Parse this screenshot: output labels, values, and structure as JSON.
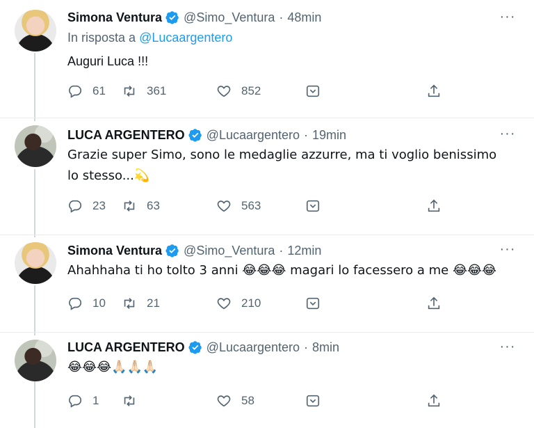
{
  "tweets": [
    {
      "name": "Simona Ventura",
      "handle": "@Simo_Ventura",
      "separator": "·",
      "time": "48min",
      "reply_prefix": "In risposta a",
      "reply_mention": "@Lucaargentero",
      "text": "Auguri Luca !!!",
      "replies": "61",
      "retweets": "361",
      "likes": "852"
    },
    {
      "name": "LUCA ARGENTERO",
      "handle": "@Lucaargentero",
      "separator": "·",
      "time": "19min",
      "text": "Grazie super Simo, sono le medaglie azzurre, ma ti voglio benissimo lo stesso...💫",
      "replies": "23",
      "retweets": "63",
      "likes": "563"
    },
    {
      "name": "Simona Ventura",
      "handle": "@Simo_Ventura",
      "separator": "·",
      "time": "12min",
      "text": "Ahahhaha ti ho tolto 3 anni 😂😂😂 magari lo facessero a me 😂😂😂",
      "replies": "10",
      "retweets": "21",
      "likes": "210"
    },
    {
      "name": "LUCA ARGENTERO",
      "handle": "@Lucaargentero",
      "separator": "·",
      "time": "8min",
      "text": "😂😂😂🙏🏻🙏🏻🙏🏻",
      "replies": "1",
      "retweets": "",
      "likes": "58"
    }
  ],
  "icons": {
    "reply": "reply-icon",
    "retweet": "retweet-icon",
    "like": "heart-icon",
    "react": "reaction-icon",
    "share": "share-icon",
    "more": "more-icon",
    "verified": "verified-badge-icon"
  },
  "colors": {
    "verified": "#1d9bf0",
    "link": "#1d9bf0",
    "muted": "#536471"
  },
  "more_glyph": "···"
}
